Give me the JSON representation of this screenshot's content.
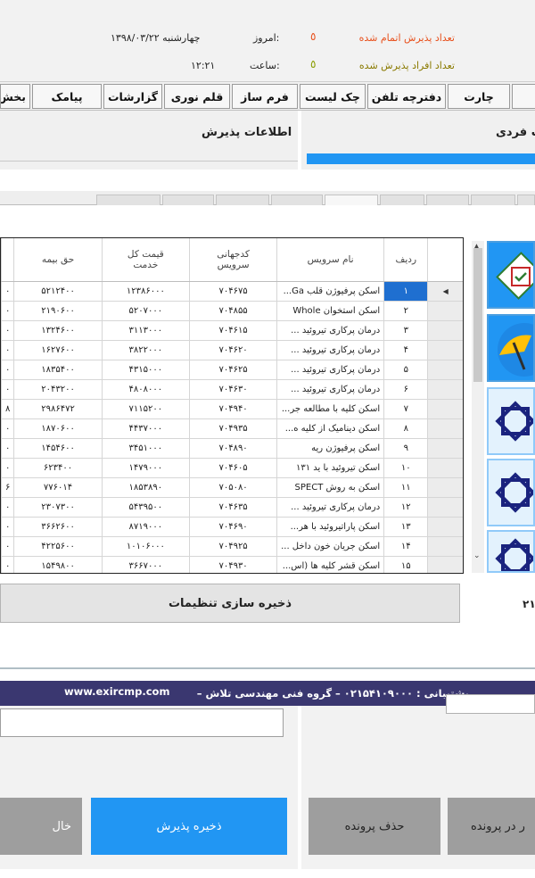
{
  "header": {
    "admissions_done_label": "تعداد پذیرش اتمام شده",
    "admitted_people_label": "تعداد افراد پذیرش شده",
    "today_label": "امروز:",
    "date_value": "چهارشنبه ۱۳۹۸/۰۳/۲۲",
    "time_label": "ساعت:",
    "time_value": "۱۲:۲۱",
    "bullet": "٥"
  },
  "menu": {
    "chart": "چارت",
    "phonebook": "دفترچه تلفن",
    "checklist": "چک لیست",
    "form_builder": "فرم ساز",
    "light_pen": "قلم نوری",
    "reports": "گزارشات",
    "sms": "پیامک",
    "section_partial": "بخش"
  },
  "panels": {
    "admission_info_title": "اطلاعات پذیرش",
    "individual_partial": "ت فردی"
  },
  "grid": {
    "headers": {
      "row": "ردیف",
      "service_name": "نام سرویس",
      "service_code_1": "کدجهانی",
      "service_code_2": "سرویس",
      "total_price_1": "قیمت کل",
      "total_price_2": "خدمت",
      "insurance_share": "حق بیمه"
    },
    "rows": [
      {
        "n": "۱",
        "name": "اسکن پرفیوژن قلب Ga...",
        "code": "۷۰۴۶۷۵",
        "price": "۱۲۳۸۶۰۰۰",
        "ins": "۵۲۱۲۴۰۰",
        "cut": "۰"
      },
      {
        "n": "۲",
        "name": "اسکن استخوان Whole",
        "code": "۷۰۴۸۵۵",
        "price": "۵۲۰۷۰۰۰",
        "ins": "۲۱۹۰۶۰۰",
        "cut": "۰"
      },
      {
        "n": "۳",
        "name": "درمان پرکاری تیروئید ...",
        "code": "۷۰۴۶۱۵",
        "price": "۳۱۱۳۰۰۰",
        "ins": "۱۳۲۴۶۰۰",
        "cut": "۰"
      },
      {
        "n": "۴",
        "name": "درمان پرکاری تیروئید ...",
        "code": "۷۰۴۶۲۰",
        "price": "۳۸۲۲۰۰۰",
        "ins": "۱۶۲۷۶۰۰",
        "cut": "۰"
      },
      {
        "n": "۵",
        "name": "درمان پرکاری تیروئید ...",
        "code": "۷۰۴۶۲۵",
        "price": "۴۳۱۵۰۰۰",
        "ins": "۱۸۳۵۴۰۰",
        "cut": "۰"
      },
      {
        "n": "۶",
        "name": "درمان پرکاری تیروئید ...",
        "code": "۷۰۴۶۳۰",
        "price": "۴۸۰۸۰۰۰",
        "ins": "۲۰۴۳۲۰۰",
        "cut": "۰"
      },
      {
        "n": "۷",
        "name": "اسکن کلیه با مطالعه جر...",
        "code": "۷۰۴۹۴۰",
        "price": "۷۱۱۵۲۰۰",
        "ins": "۲۹۸۶۴۷۲",
        "cut": "۸"
      },
      {
        "n": "۸",
        "name": "اسکن دینامیک از کلیه ه...",
        "code": "۷۰۴۹۳۵",
        "price": "۴۴۳۷۰۰۰",
        "ins": "۱۸۷۰۶۰۰",
        "cut": "۰"
      },
      {
        "n": "۹",
        "name": "اسکن پرفیوژن ریه",
        "code": "۷۰۴۸۹۰",
        "price": "۳۴۵۱۰۰۰",
        "ins": "۱۴۵۴۶۰۰",
        "cut": "۰"
      },
      {
        "n": "۱۰",
        "name": "اسکن تیروئید با ید ۱۳۱",
        "code": "۷۰۴۶۰۵",
        "price": "۱۴۷۹۰۰۰",
        "ins": "۶۲۳۴۰۰",
        "cut": "۰"
      },
      {
        "n": "۱۱",
        "name": "اسکن به روش SPECT",
        "code": "۷۰۵۰۸۰",
        "price": "۱۸۵۳۸۹۰",
        "ins": "۷۷۶۰۱۴",
        "cut": "۶"
      },
      {
        "n": "۱۲",
        "name": "درمان پرکاری تیروئید ...",
        "code": "۷۰۴۶۳۵",
        "price": "۵۴۳۹۵۰۰",
        "ins": "۲۳۰۷۳۰۰",
        "cut": "۰"
      },
      {
        "n": "۱۳",
        "name": "اسکن پاراتیروئید با هر...",
        "code": "۷۰۴۶۹۰",
        "price": "۸۷۱۹۰۰۰",
        "ins": "۳۶۶۲۶۰۰",
        "cut": "۰"
      },
      {
        "n": "۱۴",
        "name": "اسکن جریان خون داخل ...",
        "code": "۷۰۴۹۲۵",
        "price": "۱۰۱۰۶۰۰۰",
        "ins": "۴۲۲۵۶۰۰",
        "cut": "۰"
      },
      {
        "n": "۱۵",
        "name": "اسکن قشر کلیه ها (اس...",
        "code": "۷۰۴۹۳۰",
        "price": "۳۶۶۷۰۰۰",
        "ins": "۱۵۴۹۸۰۰",
        "cut": "۰"
      }
    ]
  },
  "save_settings": "ذخیره سازی تنظیمات",
  "side_number_partial": "۲۱",
  "support": {
    "text": "پشتیبانی : ۰۲۱۵۴۱۰۹۰۰۰  – گروه فنی مهندسی تلاش –",
    "url": "www.exircmp.com"
  },
  "actions": {
    "save_admission": "ذخیره پذیرش",
    "delete_file": "حذف پرونده",
    "in_file_partial": "ر در پرونده",
    "left_partial": "خال"
  },
  "colors": {
    "accent_blue": "#2196f3",
    "support_bar": "#3a3770",
    "selected_row": "#1f6fd0",
    "orange_text": "#e8501c"
  }
}
